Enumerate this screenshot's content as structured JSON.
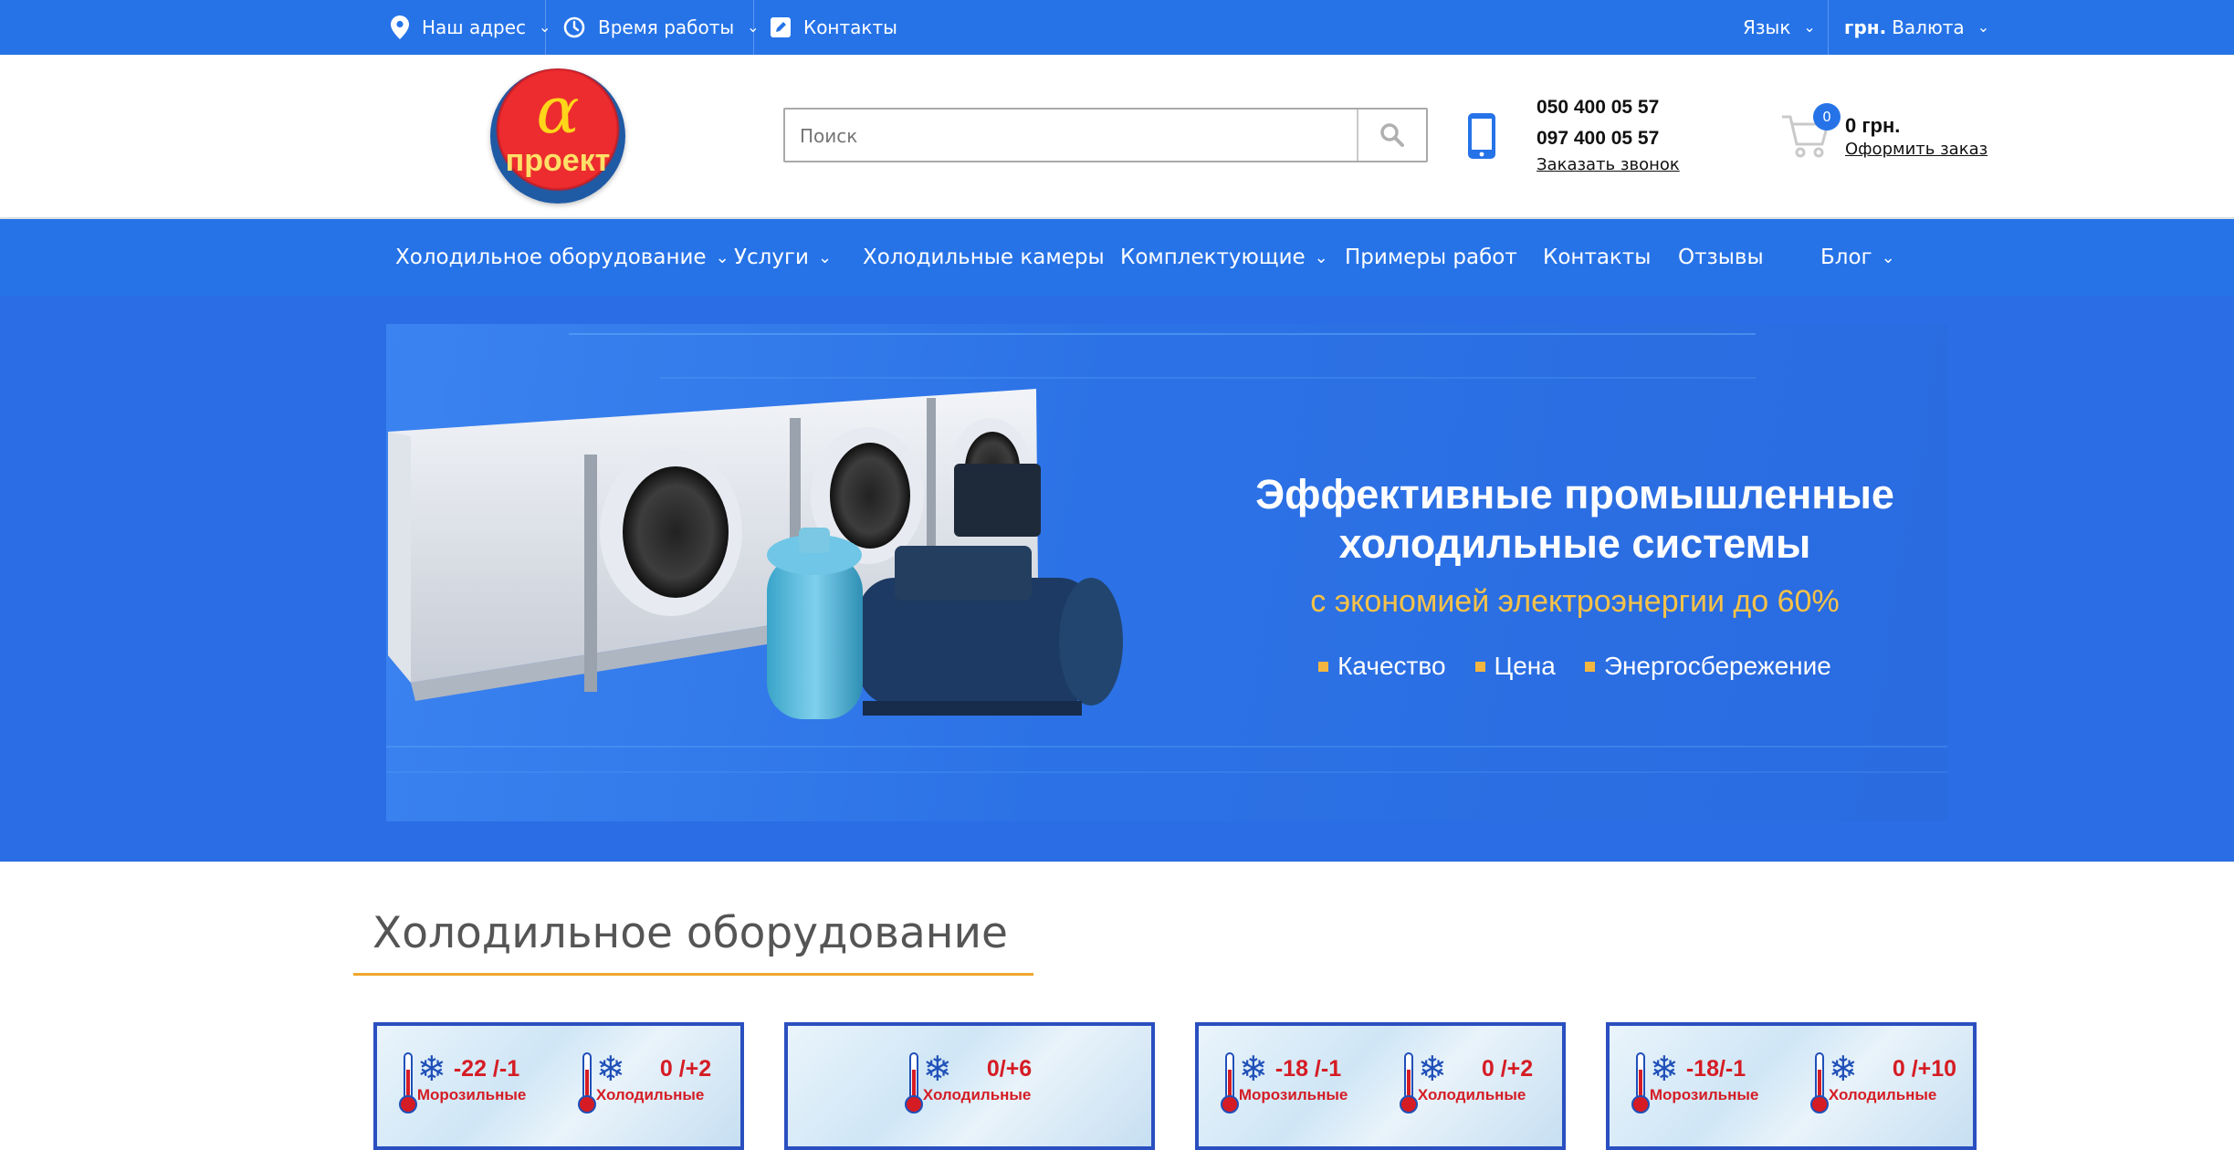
{
  "topbar": {
    "address": "Наш адрес",
    "hours": "Время работы",
    "contacts": "Контакты",
    "language": "Язык",
    "currency_code": "грн.",
    "currency_label": "Валюта"
  },
  "header": {
    "logo_alpha": "α",
    "logo_text": "проект",
    "search_placeholder": "Поиск",
    "phone1": "050 400 05 57",
    "phone2": "097 400 05 57",
    "callback": "Заказать звонок",
    "cart_count": "0",
    "cart_total": "0 грн.",
    "checkout": "Оформить заказ"
  },
  "nav": {
    "items": [
      {
        "label": "Холодильное оборудование",
        "dropdown": true
      },
      {
        "label": "Услуги",
        "dropdown": true
      },
      {
        "label": "Холодильные камеры",
        "dropdown": false
      },
      {
        "label": "Комплектующие",
        "dropdown": true
      },
      {
        "label": "Примеры работ",
        "dropdown": false
      },
      {
        "label": "Контакты",
        "dropdown": false
      },
      {
        "label": "Отзывы",
        "dropdown": false
      },
      {
        "label": "Блог",
        "dropdown": true
      }
    ]
  },
  "banner": {
    "title_line1": "Эффективные промышленные",
    "title_line2": "холодильные системы",
    "subtitle": "с экономией электроэнергии до 60%",
    "features": [
      "Качество",
      "Цена",
      "Энергосбережение"
    ]
  },
  "section": {
    "title": "Холодильное оборудование"
  },
  "cards": [
    {
      "groups": [
        {
          "temp": "-22 /-1",
          "label": "Морозильные"
        },
        {
          "temp": "0 /+2",
          "label": "Холодильные"
        }
      ]
    },
    {
      "groups": [
        {
          "temp": "0/+6",
          "label": "Холодильные"
        }
      ]
    },
    {
      "groups": [
        {
          "temp": "-18 /-1",
          "label": "Морозильные"
        },
        {
          "temp": "0 /+2",
          "label": "Холодильные"
        }
      ]
    },
    {
      "groups": [
        {
          "temp": "-18/-1",
          "label": "Морозильные"
        },
        {
          "temp": "0 /+10",
          "label": "Холодильные"
        }
      ]
    }
  ],
  "colors": {
    "brand_blue": "#2673e8",
    "accent_orange": "#f0a62c",
    "subtitle_gold": "#f7c248",
    "temp_red": "#d51c24"
  },
  "icons": {
    "address": "map-pin-icon",
    "hours": "clock-icon",
    "contacts": "edit-icon",
    "search": "search-icon",
    "phone": "mobile-phone-icon",
    "cart": "cart-icon",
    "snowflake": "snowflake-icon",
    "thermometer": "thermometer-icon"
  }
}
